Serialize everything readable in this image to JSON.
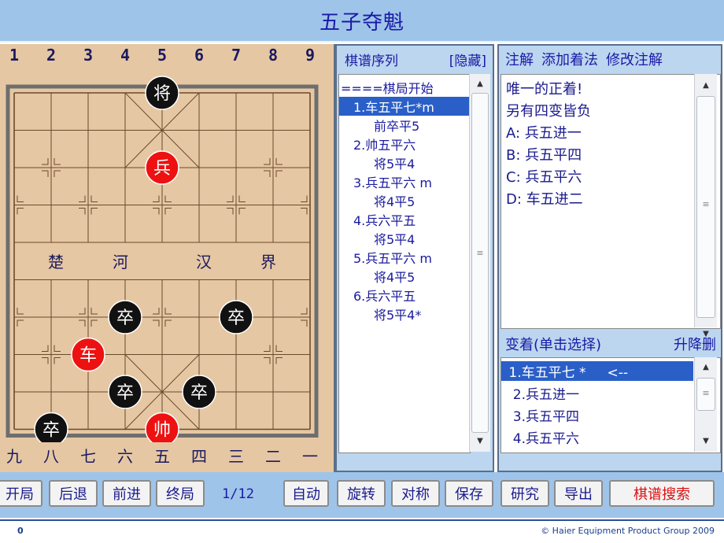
{
  "title": "五子夺魁",
  "board": {
    "top_numbers": [
      "1",
      "2",
      "3",
      "4",
      "5",
      "6",
      "7",
      "8",
      "9"
    ],
    "bottom_numbers": [
      "九",
      "八",
      "七",
      "六",
      "五",
      "四",
      "三",
      "二",
      "一"
    ],
    "river_left": [
      "楚",
      "河"
    ],
    "river_right": [
      "汉",
      "界"
    ],
    "pieces": [
      {
        "name": "black-general",
        "char": "将",
        "side": "black",
        "file": 5,
        "rank": 0
      },
      {
        "name": "red-soldier",
        "char": "兵",
        "side": "red",
        "file": 5,
        "rank": 2
      },
      {
        "name": "black-soldier-a",
        "char": "卒",
        "side": "black",
        "file": 4,
        "rank": 6
      },
      {
        "name": "black-soldier-b",
        "char": "卒",
        "side": "black",
        "file": 7,
        "rank": 6
      },
      {
        "name": "red-chariot",
        "char": "车",
        "side": "red",
        "file": 3,
        "rank": 7
      },
      {
        "name": "black-soldier-c",
        "char": "卒",
        "side": "black",
        "file": 4,
        "rank": 8
      },
      {
        "name": "black-soldier-d",
        "char": "卒",
        "side": "black",
        "file": 6,
        "rank": 8
      },
      {
        "name": "black-soldier-e",
        "char": "卒",
        "side": "black",
        "file": 2,
        "rank": 9
      },
      {
        "name": "red-general",
        "char": "帅",
        "side": "red",
        "file": 5,
        "rank": 9
      }
    ]
  },
  "movelist": {
    "header": "棋谱序列",
    "hide": "[隐藏]",
    "items": [
      {
        "text": "====棋局开始",
        "indent": 0,
        "selected": false
      },
      {
        "text": " 1.车五平七*m",
        "indent": 1,
        "selected": true
      },
      {
        "text": "前卒平5",
        "indent": 2,
        "selected": false
      },
      {
        "text": "2.帅五平六",
        "indent": 1,
        "selected": false
      },
      {
        "text": "将5平4",
        "indent": 2,
        "selected": false
      },
      {
        "text": "3.兵五平六 m",
        "indent": 1,
        "selected": false
      },
      {
        "text": "将4平5",
        "indent": 2,
        "selected": false
      },
      {
        "text": "4.兵六平五",
        "indent": 1,
        "selected": false
      },
      {
        "text": "将5平4",
        "indent": 2,
        "selected": false
      },
      {
        "text": "5.兵五平六 m",
        "indent": 1,
        "selected": false
      },
      {
        "text": "将4平5",
        "indent": 2,
        "selected": false
      },
      {
        "text": "6.兵六平五",
        "indent": 1,
        "selected": false
      },
      {
        "text": "将5平4*",
        "indent": 2,
        "selected": false
      }
    ]
  },
  "notes": {
    "tabs": [
      "注解",
      "添加着法",
      "修改注解"
    ],
    "lines": [
      "唯一的正着!",
      "另有四变皆负",
      "A: 兵五进一",
      "B: 兵五平四",
      "C: 兵五平六",
      "D: 车五进二"
    ]
  },
  "variations": {
    "header": "变着(单击选择)",
    "action": "升降删",
    "items": [
      {
        "text": " 1.车五平七 *     <--",
        "selected": true
      },
      {
        "text": "  2.兵五进一",
        "selected": false
      },
      {
        "text": "  3.兵五平四",
        "selected": false
      },
      {
        "text": "  4.兵五平六",
        "selected": false
      }
    ]
  },
  "toolbar": {
    "open": "开局",
    "back": "后退",
    "forward": "前进",
    "end": "终局",
    "counter": "1/12",
    "auto": "自动",
    "rotate": "旋转",
    "mirror": "对称",
    "save": "保存",
    "study": "研究",
    "export": "导出",
    "search": "棋谱搜索"
  },
  "footer": {
    "page": "0",
    "copyright": "© Haier Equipment Product Group 2009"
  },
  "colors": {
    "title_bg": "#9fc4ea",
    "board_bg": "#e6c7a3",
    "red_piece": "#ee1111",
    "black_piece": "#111111",
    "selection": "#2a5fc8",
    "text": "#1a1aa6"
  }
}
